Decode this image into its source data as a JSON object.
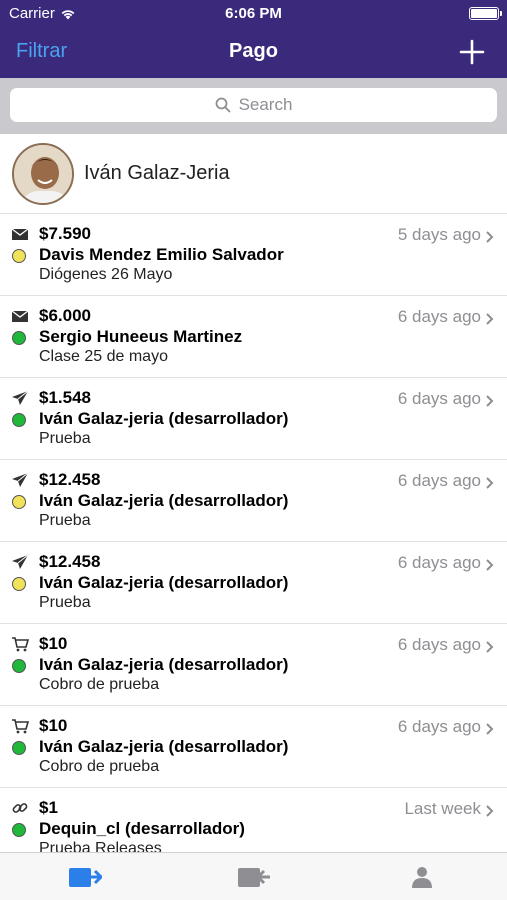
{
  "status_bar": {
    "carrier": "Carrier",
    "time": "6:06 PM"
  },
  "nav": {
    "left_label": "Filtrar",
    "title": "Pago",
    "add_icon": "plus-icon"
  },
  "search": {
    "placeholder": "Search"
  },
  "profile": {
    "name": "Iván Galaz-Jeria"
  },
  "colors": {
    "nav_bg": "#3b2a7c",
    "accent": "#4aa3f0",
    "dot_yellow": "#f1e15b",
    "dot_green": "#1fb83a"
  },
  "payments": [
    {
      "icon": "envelope-icon",
      "amount": "$7.590",
      "payer": "Davis Mendez Emilio Salvador",
      "description": "Diógenes 26 Mayo",
      "time": "5 days ago",
      "status": "yellow"
    },
    {
      "icon": "envelope-icon",
      "amount": "$6.000",
      "payer": "Sergio Huneeus Martinez",
      "description": "Clase 25 de mayo",
      "time": "6 days ago",
      "status": "green"
    },
    {
      "icon": "send-icon",
      "amount": "$1.548",
      "payer": "Iván Galaz-jeria (desarrollador)",
      "description": "Prueba",
      "time": "6 days ago",
      "status": "green"
    },
    {
      "icon": "send-icon",
      "amount": "$12.458",
      "payer": "Iván Galaz-jeria (desarrollador)",
      "description": "Prueba",
      "time": "6 days ago",
      "status": "yellow"
    },
    {
      "icon": "send-icon",
      "amount": "$12.458",
      "payer": "Iván Galaz-jeria (desarrollador)",
      "description": "Prueba",
      "time": "6 days ago",
      "status": "yellow"
    },
    {
      "icon": "cart-icon",
      "amount": "$10",
      "payer": "Iván Galaz-jeria (desarrollador)",
      "description": "Cobro de prueba",
      "time": "6 days ago",
      "status": "green"
    },
    {
      "icon": "cart-icon",
      "amount": "$10",
      "payer": "Iván Galaz-jeria (desarrollador)",
      "description": "Cobro de prueba",
      "time": "6 days ago",
      "status": "green"
    },
    {
      "icon": "link-icon",
      "amount": "$1",
      "payer": "Dequin_cl (desarrollador)",
      "description": "Prueba Releases",
      "time": "Last week",
      "status": "green"
    }
  ],
  "tabs": [
    {
      "name": "tab-incoming-payments",
      "icon": "wallet-in-icon",
      "active": true
    },
    {
      "name": "tab-outgoing-payments",
      "icon": "wallet-out-icon",
      "active": false
    },
    {
      "name": "tab-profile",
      "icon": "person-icon",
      "active": false
    }
  ]
}
